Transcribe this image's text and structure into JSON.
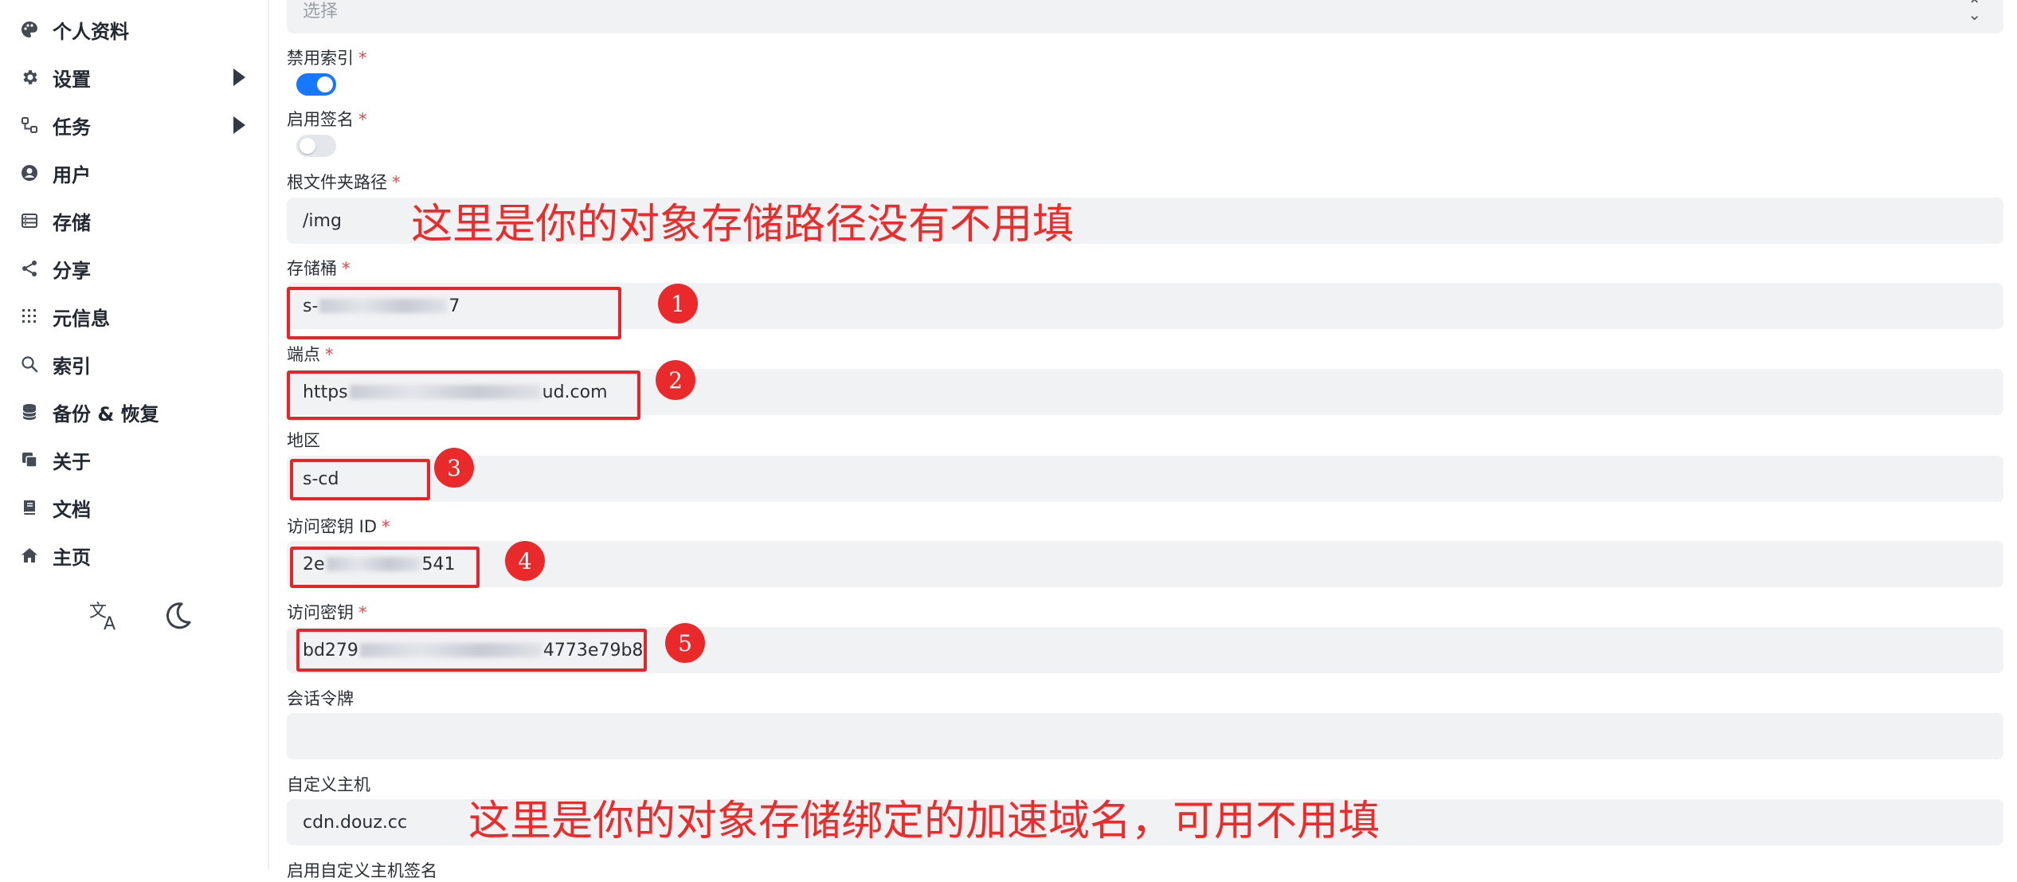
{
  "sidebar": {
    "items": [
      {
        "label": "个人资料",
        "icon": "palette-icon"
      },
      {
        "label": "设置",
        "icon": "gear-icon"
      },
      {
        "label": "任务",
        "icon": "flow-icon"
      },
      {
        "label": "用户",
        "icon": "user-circle-icon"
      },
      {
        "label": "存储",
        "icon": "database-icon"
      },
      {
        "label": "分享",
        "icon": "share-icon"
      },
      {
        "label": "元信息",
        "icon": "grid-icon"
      },
      {
        "label": "索引",
        "icon": "search-icon"
      },
      {
        "label": "备份 & 恢复",
        "icon": "stack-icon"
      },
      {
        "label": "关于",
        "icon": "copy-icon"
      },
      {
        "label": "文档",
        "icon": "book-icon"
      },
      {
        "label": "主页",
        "icon": "home-icon"
      }
    ],
    "tools": {
      "translate_icon": "translate-icon",
      "theme_icon": "moon-icon"
    }
  },
  "form": {
    "select_placeholder": "选择",
    "disable_index": {
      "label": "禁用索引",
      "required": "*",
      "value": true
    },
    "enable_sign": {
      "label": "启用签名",
      "required": "*",
      "value": false
    },
    "root_path": {
      "label": "根文件夹路径",
      "required": "*",
      "value": "/img"
    },
    "bucket": {
      "label": "存储桶",
      "required": "*",
      "value_prefix": "s-",
      "value_suffix": "7"
    },
    "endpoint": {
      "label": "端点",
      "required": "*",
      "value_prefix": "https",
      "value_suffix": "ud.com"
    },
    "region": {
      "label": "地区",
      "value": "s-cd"
    },
    "access_key_id": {
      "label": "访问密钥 ID",
      "required": "*",
      "value_prefix": "2e",
      "value_suffix": "541"
    },
    "secret_key": {
      "label": "访问密钥",
      "required": "*",
      "value_prefix": "bd279",
      "value_suffix": "4773e79b8"
    },
    "session_token": {
      "label": "会话令牌",
      "value": ""
    },
    "custom_host": {
      "label": "自定义主机",
      "value": "cdn.douz.cc"
    },
    "custom_host_sign": {
      "label": "启用自定义主机签名"
    }
  },
  "annotations": {
    "root_path_note": "这里是你的对象存储路径没有不用填",
    "custom_host_note": "这里是你的对象存储绑定的加速域名，可用不用填",
    "badges": [
      "1",
      "2",
      "3",
      "4",
      "5"
    ],
    "color": "#ee2b2b"
  },
  "colors": {
    "toggle_on": "#1677ff",
    "toggle_off": "#e3e6ea",
    "input_bg": "#f1f2f4",
    "required": "#e5484d"
  }
}
